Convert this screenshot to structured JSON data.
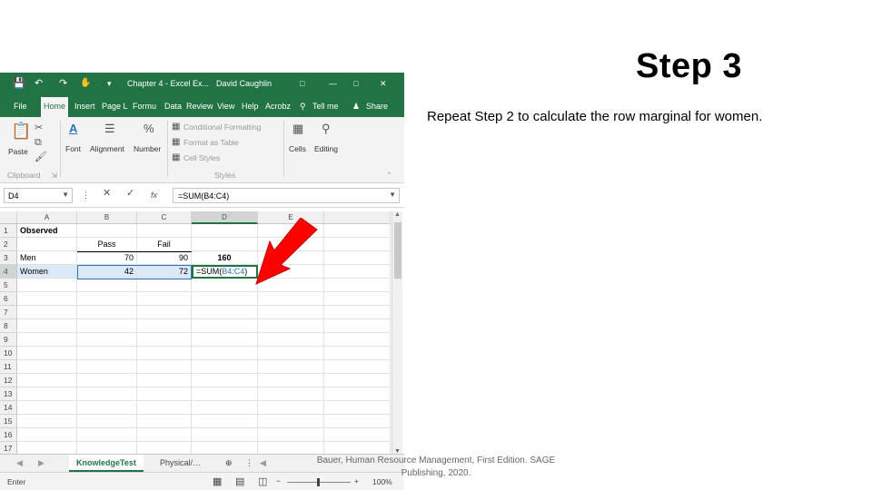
{
  "slide": {
    "title": "Step 3",
    "body": "Repeat Step 2 to calculate the row marginal for women.",
    "footer": "Bauer, Human Resource Management, First Edition. SAGE Publishing, 2020."
  },
  "excel": {
    "window_title": "Chapter 4 - Excel Ex...",
    "user": "David Caughlin",
    "menu": [
      "File",
      "Home",
      "Insert",
      "Page L",
      "Formu",
      "Data",
      "Review",
      "View",
      "Help",
      "Acrobz",
      "Tell me",
      "Share"
    ],
    "ribbon": {
      "paste": "Paste",
      "clipboard": "Clipboard",
      "font": "Font",
      "alignment": "Alignment",
      "number": "Number",
      "conditional_formatting": "Conditional Formatting",
      "format_as_table": "Format as Table",
      "cell_styles": "Cell Styles",
      "styles": "Styles",
      "cells": "Cells",
      "editing": "Editing"
    },
    "name_box": "D4",
    "formula": "=SUM(B4:C4)",
    "fx": "fx",
    "columns": [
      "A",
      "B",
      "C",
      "D",
      "E"
    ],
    "rows": [
      "1",
      "2",
      "3",
      "4",
      "5",
      "6",
      "7",
      "8",
      "9",
      "10",
      "11",
      "12",
      "13",
      "14",
      "15",
      "16",
      "17"
    ],
    "cells": {
      "A1": "Observed",
      "B2": "Pass",
      "C2": "Fail",
      "A3": "Men",
      "B3": "70",
      "C3": "90",
      "D3": "160",
      "A4": "Women",
      "B4": "42",
      "C4": "72",
      "D4_prefix": "=SUM(",
      "D4_ref": "B4:C4",
      "D4_suffix": ")"
    },
    "sheet_tabs": [
      "KnowledgeTest",
      "Physical/…"
    ],
    "status": "Enter",
    "zoom": "100%",
    "colors": {
      "excel_green": "#217346",
      "arrow_red": "#ff0000",
      "ref_blue": "#2e75b6"
    }
  }
}
